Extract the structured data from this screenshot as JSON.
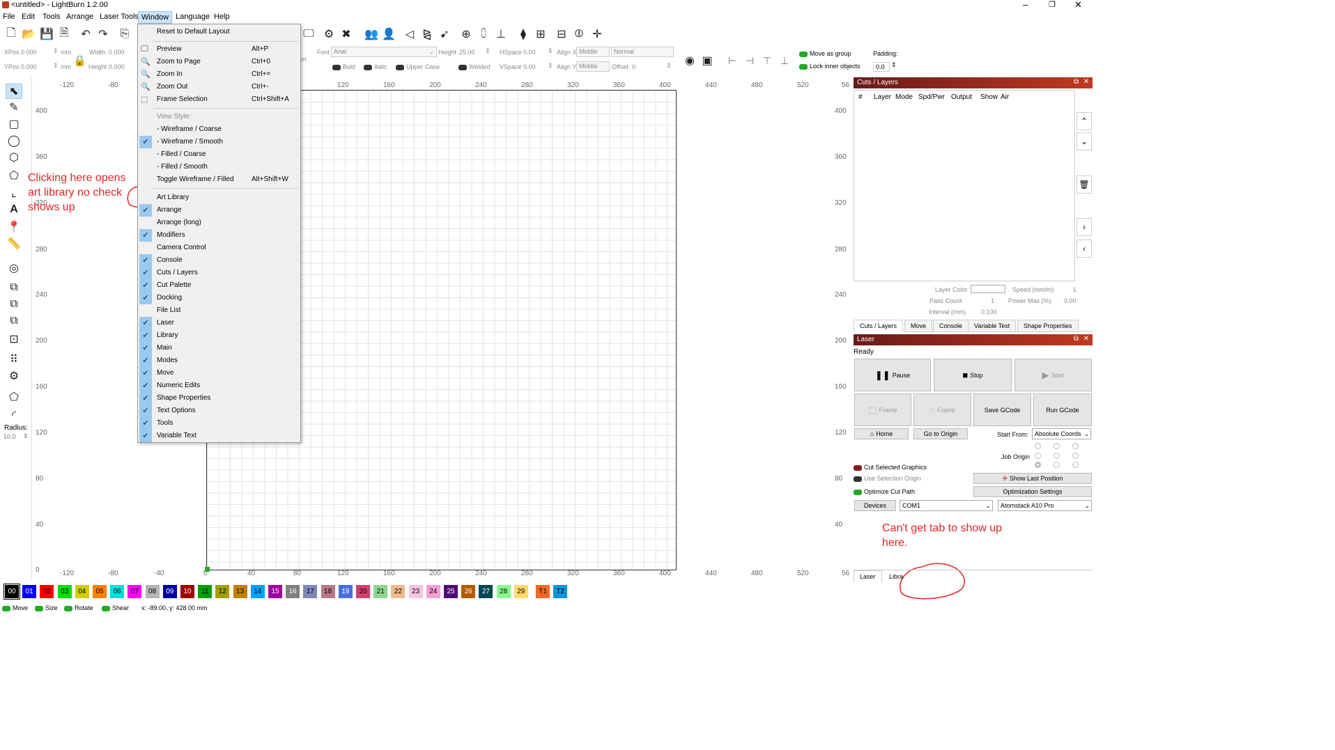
{
  "app": {
    "title": "<untitled> - LightBurn 1.2.00"
  },
  "menubar": [
    "File",
    "Edit",
    "Tools",
    "Arrange",
    "Laser Tools",
    "Window",
    "Language",
    "Help"
  ],
  "toolbar2": {
    "xpos_label": "XPos",
    "xpos": "0.000",
    "ypos_label": "YPos",
    "ypos": "0.000",
    "unit": "mm",
    "width_label": "Width",
    "width": "0.000",
    "height_label": "Height",
    "height": "0.000",
    "font_label": "Font",
    "font": "Arial",
    "theight_label": "Height",
    "theight": "25.00",
    "hspace_label": "HSpace",
    "hspace": "0.00",
    "vspace_label": "VSpace",
    "vspace": "0.00",
    "alignx_label": "Align X",
    "alignx": "Middle",
    "aligny_label": "Align Y",
    "aligny": "Middle",
    "normal": "Normal",
    "offset_label": "Offset",
    "offset": "0",
    "bold": "Bold",
    "italic": "Italic",
    "upper": "Upper Case",
    "welded": "Welded",
    "move_group": "Move as group",
    "lock_inner": "Lock inner objects",
    "padding_label": "Padding:",
    "padding": "0.0",
    "mm_small": "m"
  },
  "left": {
    "radius_label": "Radius:",
    "radius": "10.0"
  },
  "ruler_top": [
    "-120",
    "-80",
    "120",
    "160",
    "200",
    "240",
    "280",
    "320",
    "360",
    "400",
    "440",
    "480",
    "520",
    "56"
  ],
  "ruler_bottom": [
    "-120",
    "-80",
    "-40",
    "0",
    "40",
    "80",
    "120",
    "160",
    "200",
    "240",
    "280",
    "320",
    "360",
    "400",
    "440",
    "480",
    "520",
    "56"
  ],
  "ruler_left": [
    "400",
    "360",
    "320",
    "280",
    "240",
    "200",
    "160",
    "120",
    "80",
    "40",
    "0"
  ],
  "ruler_right": [
    "400",
    "360",
    "320",
    "280",
    "240",
    "200",
    "160",
    "120",
    "80",
    "40"
  ],
  "window_menu": {
    "top": [
      {
        "label": "Reset to Default Layout",
        "shortcut": ""
      }
    ],
    "view": [
      {
        "label": "Preview",
        "shortcut": "Alt+P",
        "icon": "monitor-icon"
      },
      {
        "label": "Zoom to Page",
        "shortcut": "Ctrl+0",
        "icon": "zoom-icon"
      },
      {
        "label": "Zoom In",
        "shortcut": "Ctrl+=",
        "icon": "zoom-in-icon"
      },
      {
        "label": "Zoom Out",
        "shortcut": "Ctrl+-",
        "icon": "zoom-out-icon"
      },
      {
        "label": "Frame Selection",
        "shortcut": "Ctrl+Shift+A",
        "icon": "frame-selection-icon"
      }
    ],
    "view_style_label": "View Style:",
    "styles": [
      {
        "label": "- Wireframe / Coarse",
        "checked": false
      },
      {
        "label": "- Wireframe / Smooth",
        "checked": true
      },
      {
        "label": "- Filled / Coarse",
        "checked": false
      },
      {
        "label": "- Filled / Smooth",
        "checked": false
      }
    ],
    "toggle": {
      "label": "Toggle Wireframe / Filled",
      "shortcut": "Alt+Shift+W"
    },
    "windows": [
      {
        "label": "Art Library",
        "checked": false
      },
      {
        "label": "Arrange",
        "checked": true
      },
      {
        "label": "Arrange (long)",
        "checked": false
      },
      {
        "label": "Modifiers",
        "checked": true
      },
      {
        "label": "Camera Control",
        "checked": false
      },
      {
        "label": "Console",
        "checked": true
      },
      {
        "label": "Cuts / Layers",
        "checked": true
      },
      {
        "label": "Cut Palette",
        "checked": true
      },
      {
        "label": "Docking",
        "checked": true
      },
      {
        "label": "File List",
        "checked": false
      },
      {
        "label": "Laser",
        "checked": true
      },
      {
        "label": "Library",
        "checked": true
      },
      {
        "label": "Main",
        "checked": true
      },
      {
        "label": "Modes",
        "checked": true
      },
      {
        "label": "Move",
        "checked": true
      },
      {
        "label": "Numeric Edits",
        "checked": true
      },
      {
        "label": "Shape Properties",
        "checked": true
      },
      {
        "label": "Text Options",
        "checked": true
      },
      {
        "label": "Tools",
        "checked": true
      },
      {
        "label": "Variable Text",
        "checked": true
      }
    ]
  },
  "annotations": {
    "a1": "Clicking here opens art library no check shows up",
    "a2": "Can't get tab to show up here."
  },
  "cuts": {
    "title": "Cuts / Layers",
    "headers": [
      "#",
      "Layer",
      "Mode",
      "Spd/Pwr",
      "Output",
      "Show",
      "Air"
    ],
    "layer_color": "Layer Color",
    "speed": "Speed (mm/m)",
    "speed_v": "1",
    "pass": "Pass Count",
    "pass_v": "1",
    "power": "Power Max (%)",
    "power_v": "0.00",
    "interval": "Interval (mm)",
    "interval_v": "0.100",
    "tabs": [
      "Cuts / Layers",
      "Move",
      "Console",
      "Variable Text",
      "Shape Properties"
    ]
  },
  "laser": {
    "title": "Laser",
    "status": "Ready",
    "pause": "Pause",
    "stop": "Stop",
    "start": "Start",
    "frame1": "Frame",
    "frame2": "Frame",
    "save_gcode": "Save GCode",
    "run_gcode": "Run GCode",
    "home": "Home",
    "goto_origin": "Go to Origin",
    "start_from_label": "Start From:",
    "start_from": "Absolute Coords",
    "job_origin": "Job Origin",
    "cut_selected": "Cut Selected Graphics",
    "use_sel_origin": "Use Selection Origin",
    "optimize": "Optimize Cut Path",
    "show_last": "Show Last Position",
    "opt_settings": "Optimization Settings",
    "devices": "Devices",
    "port": "COM1",
    "device": "Atomstack A10 Pro",
    "tabs": [
      "Laser",
      "Libra"
    ]
  },
  "palette": [
    {
      "label": "00",
      "color": "#000000",
      "fg": "#ffffff"
    },
    {
      "label": "01",
      "color": "#0000ff",
      "fg": "#ffffff"
    },
    {
      "label": "02",
      "color": "#ff0000",
      "fg": "#000000"
    },
    {
      "label": "03",
      "color": "#00e000",
      "fg": "#000000"
    },
    {
      "label": "04",
      "color": "#d0d000",
      "fg": "#000000"
    },
    {
      "label": "05",
      "color": "#ff8000",
      "fg": "#000000"
    },
    {
      "label": "06",
      "color": "#00e0e0",
      "fg": "#000000"
    },
    {
      "label": "07",
      "color": "#ff00ff",
      "fg": "#000000"
    },
    {
      "label": "08",
      "color": "#b4b4b4",
      "fg": "#000000"
    },
    {
      "label": "09",
      "color": "#0000a0",
      "fg": "#ffffff"
    },
    {
      "label": "10",
      "color": "#a00000",
      "fg": "#ffffff"
    },
    {
      "label": "11",
      "color": "#00a000",
      "fg": "#000000"
    },
    {
      "label": "12",
      "color": "#a0a000",
      "fg": "#000000"
    },
    {
      "label": "13",
      "color": "#c08000",
      "fg": "#000000"
    },
    {
      "label": "14",
      "color": "#00a0ff",
      "fg": "#000000"
    },
    {
      "label": "15",
      "color": "#a000a0",
      "fg": "#ffffff"
    },
    {
      "label": "16",
      "color": "#808080",
      "fg": "#ffffff"
    },
    {
      "label": "17",
      "color": "#7d87b9",
      "fg": "#000000"
    },
    {
      "label": "18",
      "color": "#bb7784",
      "fg": "#000000"
    },
    {
      "label": "19",
      "color": "#4a6fe3",
      "fg": "#ffffff"
    },
    {
      "label": "20",
      "color": "#d33f6a",
      "fg": "#000000"
    },
    {
      "label": "21",
      "color": "#8cd78c",
      "fg": "#000000"
    },
    {
      "label": "22",
      "color": "#f0b98d",
      "fg": "#000000"
    },
    {
      "label": "23",
      "color": "#f6c4e1",
      "fg": "#000000"
    },
    {
      "label": "24",
      "color": "#fa9ed4",
      "fg": "#000000"
    },
    {
      "label": "25",
      "color": "#500a78",
      "fg": "#ffffff"
    },
    {
      "label": "26",
      "color": "#b45a00",
      "fg": "#ffffff"
    },
    {
      "label": "27",
      "color": "#004754",
      "fg": "#ffffff"
    },
    {
      "label": "28",
      "color": "#86fa88",
      "fg": "#000000"
    },
    {
      "label": "29",
      "color": "#ffdb66",
      "fg": "#000000"
    },
    {
      "label": "T1",
      "color": "#f36926",
      "fg": "#000000"
    },
    {
      "label": "T2",
      "color": "#0c96d9",
      "fg": "#000000"
    }
  ],
  "status": {
    "move": "Move",
    "size": "Size",
    "rotate": "Rotate",
    "shear": "Shear",
    "coords": "x: -89.00, y: 428.00 mm"
  }
}
